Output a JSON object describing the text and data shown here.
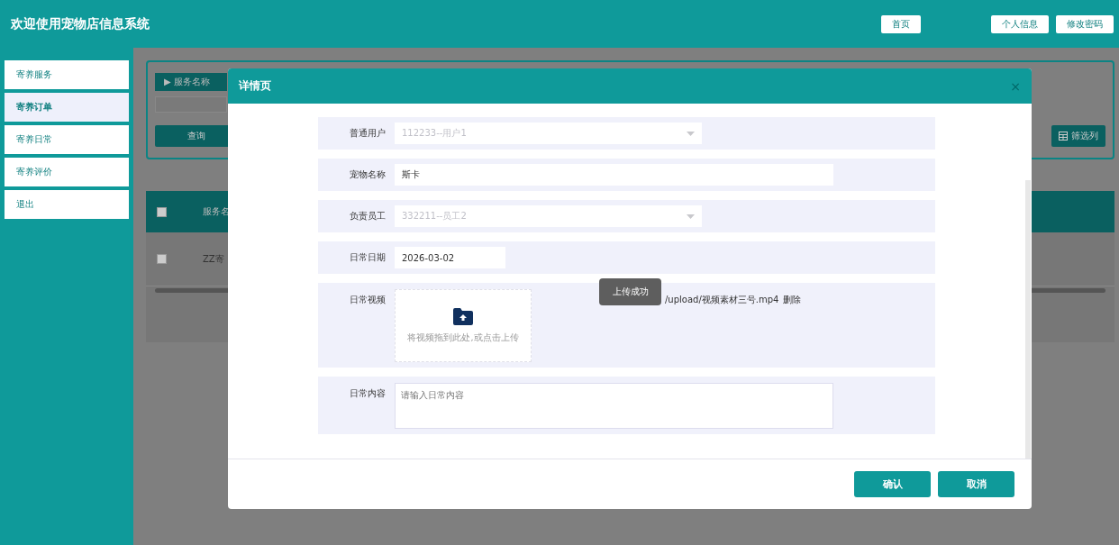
{
  "header": {
    "title": "欢迎使用宠物店信息系统",
    "nav": [
      {
        "label": "首页"
      },
      {
        "label": "个人信息"
      },
      {
        "label": "修改密码"
      }
    ]
  },
  "sidebar": {
    "items": [
      {
        "label": "寄养服务",
        "selected": false
      },
      {
        "label": "寄养订单",
        "selected": true
      },
      {
        "label": "寄养日常",
        "selected": false
      },
      {
        "label": "寄养评价",
        "selected": false
      },
      {
        "label": "退出",
        "selected": false
      }
    ]
  },
  "search_panel": {
    "section_label": "▶ 服务名称",
    "buttons": [
      {
        "label": "查询",
        "kind": "plain"
      },
      {
        "label": "筛选列",
        "kind": "icon"
      }
    ]
  },
  "table": {
    "all_checked": false,
    "columns": [
      "服务名"
    ],
    "rows": [
      {
        "checked": false,
        "cells": [
          "ZZ寄"
        ]
      }
    ]
  },
  "dialog": {
    "title": "详情页",
    "close": "×",
    "fields": [
      {
        "kind": "select",
        "label": "普通用户",
        "value": "112233--用户1",
        "disabled": true
      },
      {
        "kind": "text",
        "label": "宠物名称",
        "value": "斯卡",
        "disabled": false
      },
      {
        "kind": "select",
        "label": "负责员工",
        "value": "332211--员工2",
        "disabled": true
      },
      {
        "kind": "date",
        "label": "日常日期",
        "value": "2026-03-02",
        "disabled": false
      },
      {
        "kind": "upload",
        "label": "日常视频",
        "hint": "将视频拖到此处,或点击上传",
        "file": "/upload/视频素材三号.mp4",
        "delete_label": "删除",
        "disabled": false
      },
      {
        "kind": "textarea",
        "label": "日常内容",
        "placeholder": "请输入日常内容",
        "disabled": false
      }
    ],
    "toast": "上传成功",
    "buttons": [
      {
        "label": "确认"
      },
      {
        "label": "取消"
      }
    ]
  }
}
